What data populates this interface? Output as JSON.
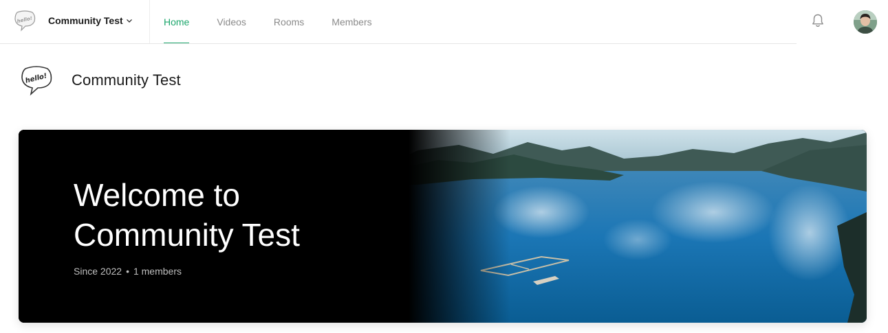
{
  "app": {
    "logo_icon": "hello-speech-bubble-icon",
    "community_switcher_label": "Community Test",
    "switcher_icon": "chevron-down-icon"
  },
  "nav": {
    "items": [
      {
        "label": "Home",
        "active": true
      },
      {
        "label": "Videos",
        "active": false
      },
      {
        "label": "Rooms",
        "active": false
      },
      {
        "label": "Members",
        "active": false
      }
    ],
    "accent_color": "#1ba66b"
  },
  "header_right": {
    "notification_icon": "bell-icon",
    "avatar_icon": "user-avatar"
  },
  "community": {
    "logo_text": "hello!",
    "name": "Community Test"
  },
  "hero": {
    "title": "Welcome to Community Test",
    "since": "Since 2022",
    "separator": "•",
    "members": "1 members",
    "image_subject": "aerial-lake-mountains-image"
  }
}
